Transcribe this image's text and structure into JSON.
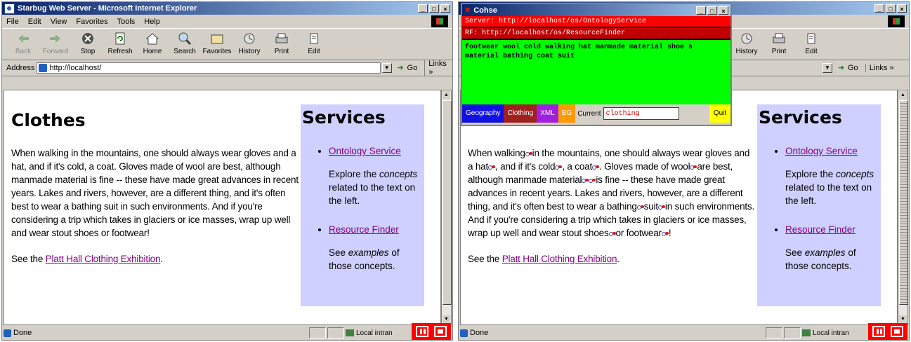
{
  "left_window": {
    "title": "Starbug Web Server - Microsoft Internet Explorer",
    "win_buttons": [
      "_",
      "□",
      "×"
    ],
    "menu": [
      "File",
      "Edit",
      "View",
      "Favorites",
      "Tools",
      "Help"
    ],
    "toolbar": [
      "Back",
      "Forward",
      "Stop",
      "Refresh",
      "Home",
      "Search",
      "Favorites",
      "History",
      "Print",
      "Edit"
    ],
    "address_label": "Address",
    "address": "http://localhost/",
    "go_label": "Go",
    "links_label": "Links »",
    "status": "Done",
    "zone": "Local intran"
  },
  "right_window": {
    "win_buttons": [
      "_",
      "□",
      "×"
    ],
    "toolbar_visible": [
      "History",
      "Print",
      "Edit"
    ],
    "go_label": "Go",
    "links_label": "Links »",
    "status": "Done",
    "zone": "Local intran"
  },
  "page": {
    "heading": "Clothes",
    "paragraph": "When walking in the mountains, one should always wear gloves and a hat, and if it's cold, a coat. Gloves made of wool are best, although manmade material is fine -- these have made great advances in recent years. Lakes and rivers, however, are a different thing, and it's often best to wear a bathing suit in such environments. And if you're considering a trip which takes in glaciers or ice masses, wrap up well and wear stout shoes or footwear!",
    "see_prefix": "See the ",
    "exhibition_link": "Platt Hall Clothing Exhibition",
    "see_suffix": ".",
    "services_heading": "Services",
    "service1_link": "Ontology Service",
    "service1_desc_a": "Explore the ",
    "service1_desc_em": "concepts",
    "service1_desc_b": " related to the text on the left.",
    "service2_link": "Resource Finder",
    "service2_desc_a": "See ",
    "service2_desc_em": "examples",
    "service2_desc_b": " of those concepts."
  },
  "annotated": {
    "p1": "When walking",
    "p2": "in the mountains, one should always wear gloves and a hat",
    "p3": ", and if it's cold",
    "p4": ", a coat",
    "p5": ". Gloves made of wool",
    "p6": "are best, although manmade material",
    "p7": "is fine -- these have made great advances in recent years. Lakes and rivers, however, are a different thing, and it's often best to wear a bathing",
    "p8": "suit",
    "p9": "in such environments. And if you're considering a trip which takes in glaciers or ice masses, wrap up well and wear stout shoes",
    "p10": "or footwear",
    "p11": "!"
  },
  "cohse": {
    "title": "Cohse",
    "server1": "Server: http://localhost/os/OntologyService",
    "server2": "RF: http://localhost/os/ResourceFinder",
    "terms": "footwear wool cold walking hat manmade material shoe s material bathing coat suit",
    "tabs": [
      {
        "label": "Geography",
        "color": "#1010e0"
      },
      {
        "label": "Clothing",
        "color": "#a02020"
      },
      {
        "label": "XML",
        "color": "#a020e0"
      },
      {
        "label": "BG",
        "color": "#ff9900"
      }
    ],
    "current_label": "Current",
    "current_value": "clothing",
    "quit_label": "Quit"
  }
}
